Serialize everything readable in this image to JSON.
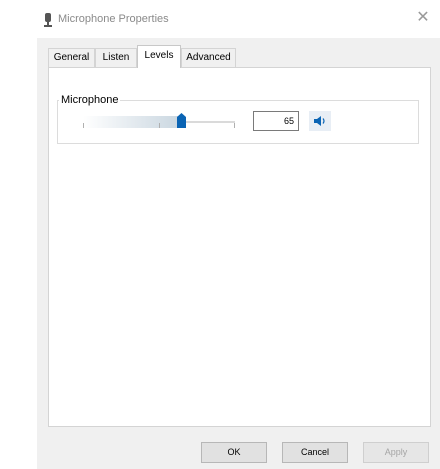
{
  "window": {
    "title": "Microphone Properties",
    "close_glyph": "✕"
  },
  "tabs": [
    {
      "label": "General",
      "active": false
    },
    {
      "label": "Listen",
      "active": false
    },
    {
      "label": "Levels",
      "active": true
    },
    {
      "label": "Advanced",
      "active": false
    }
  ],
  "levels": {
    "group_label": "Microphone",
    "volume_value": "65",
    "volume_fraction": 0.65,
    "speaker_icon": "speaker-icon"
  },
  "buttons": {
    "ok_label": "OK",
    "cancel_label": "Cancel",
    "apply_label": "Apply"
  },
  "colors": {
    "accent": "#0a64b4"
  }
}
